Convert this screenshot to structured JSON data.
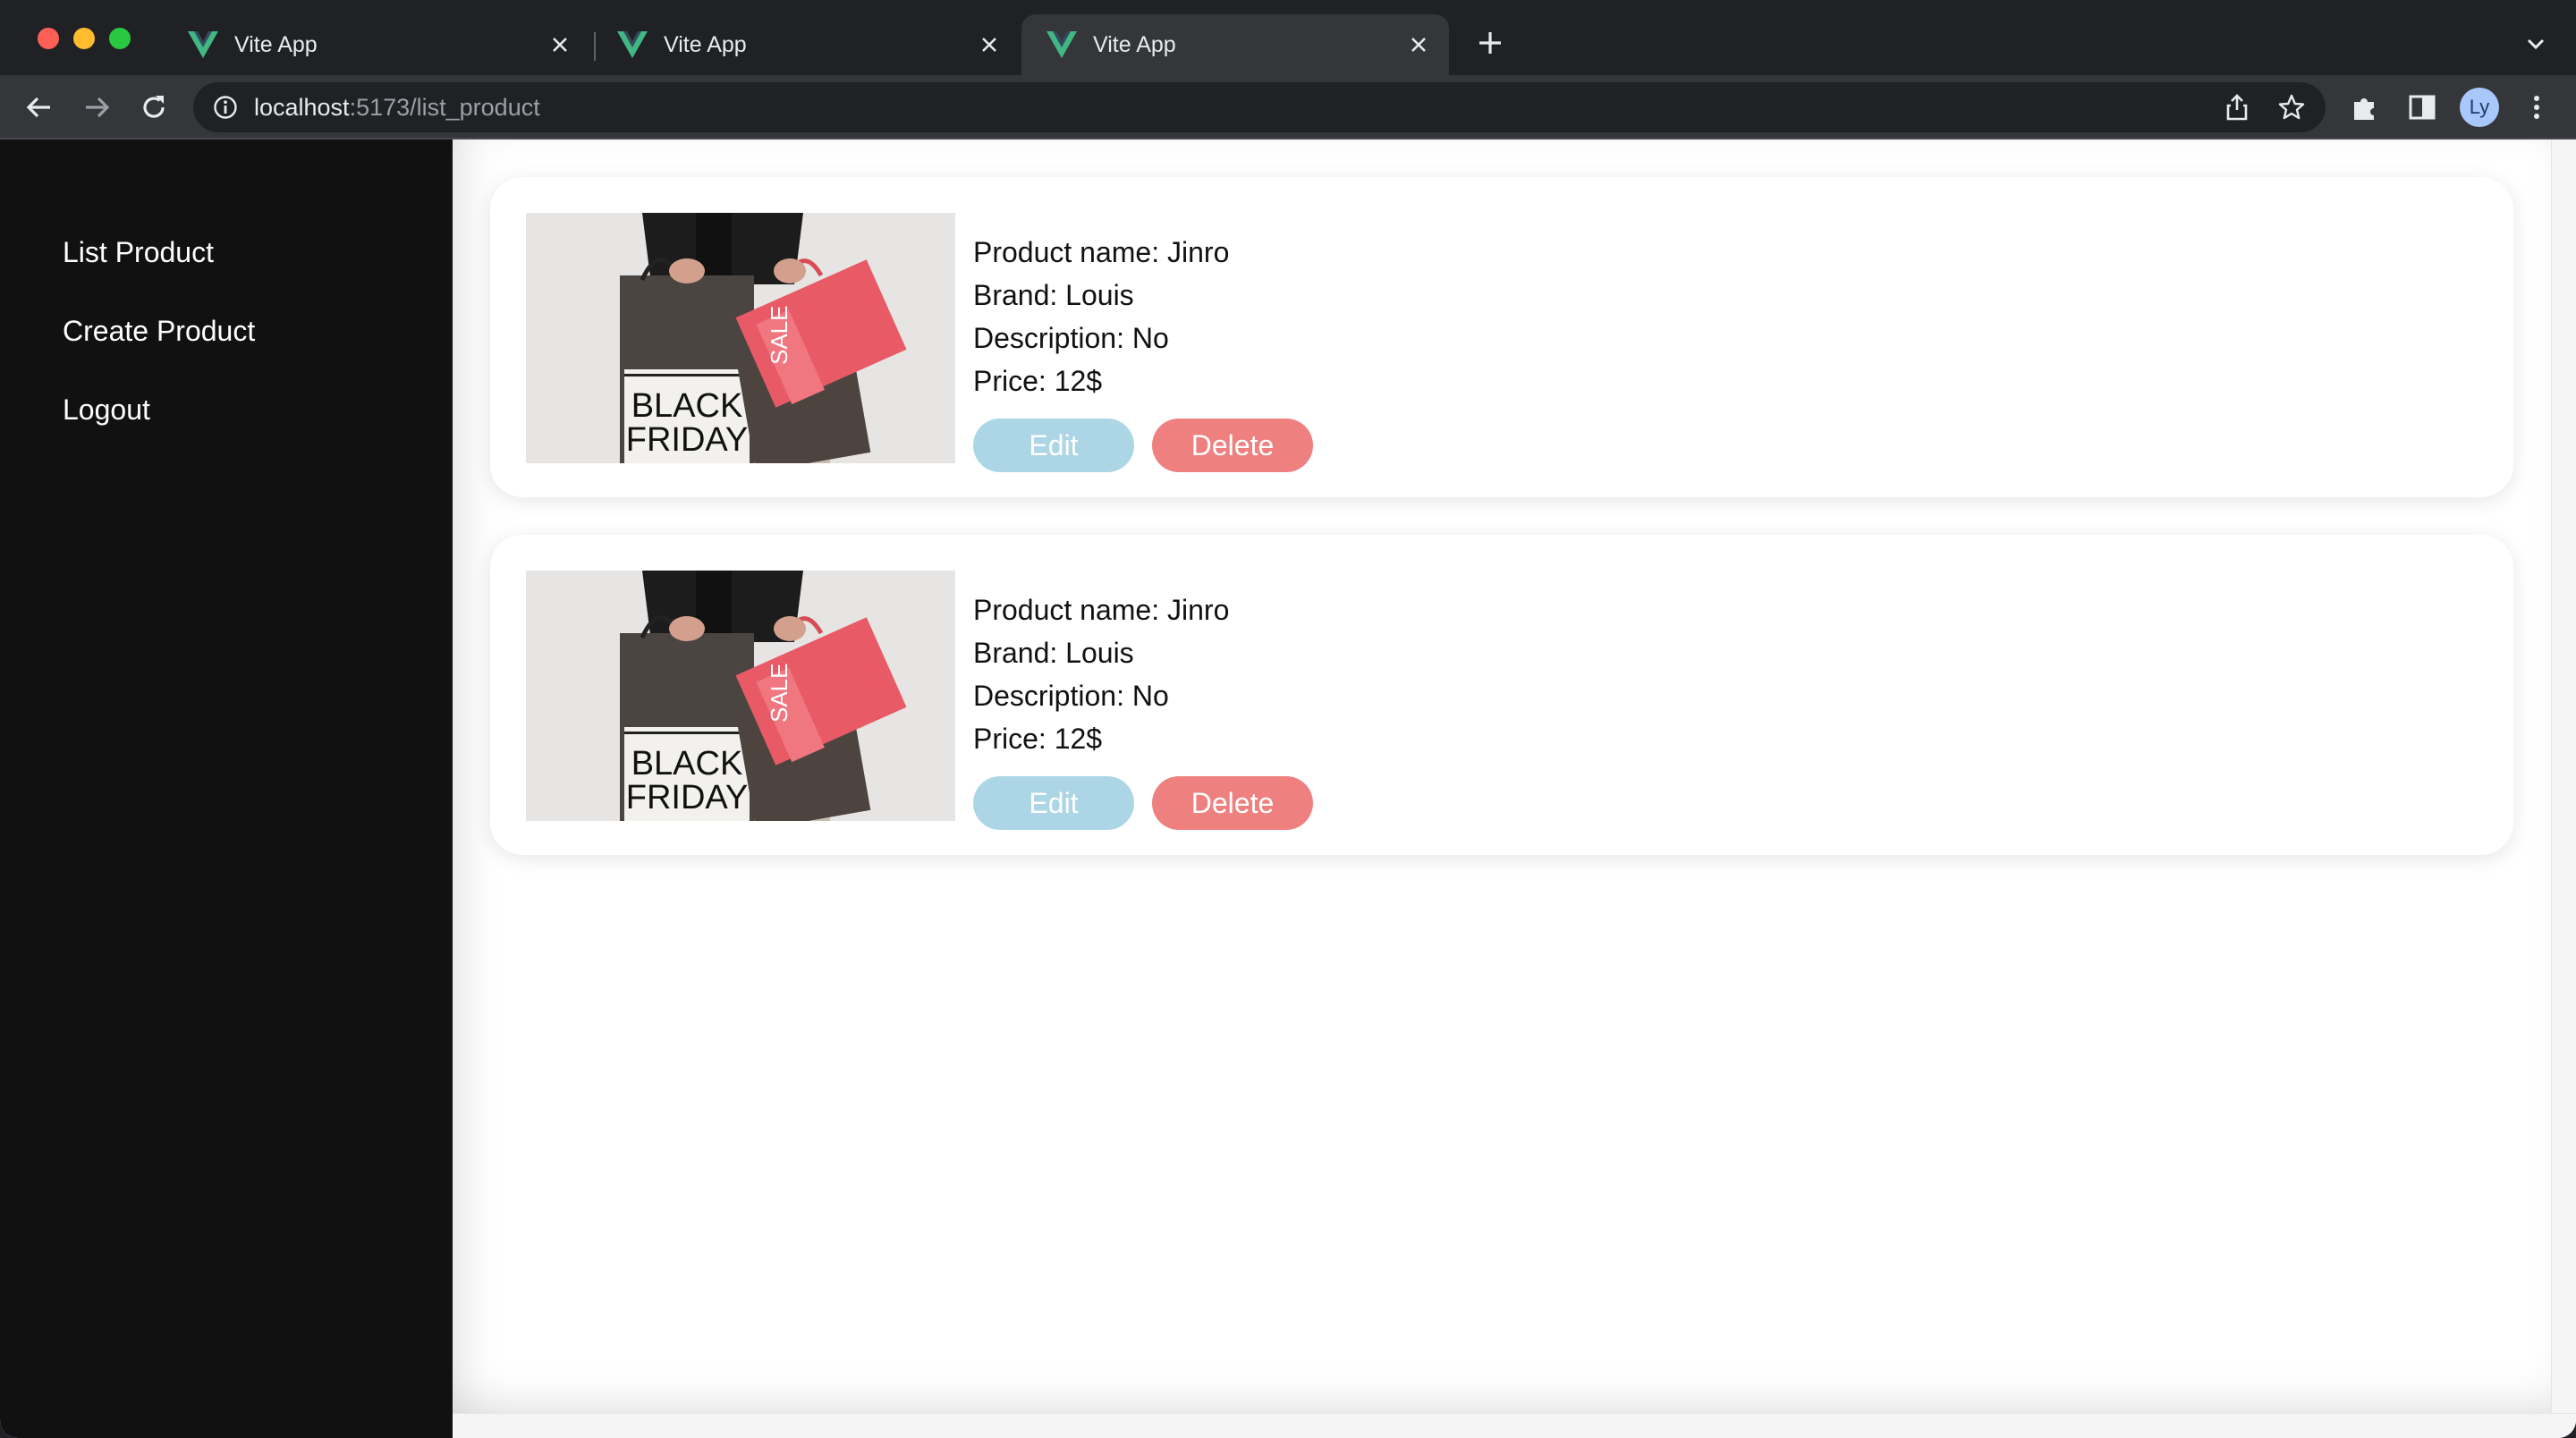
{
  "browser": {
    "tabs": [
      {
        "title": "Vite App",
        "active": false
      },
      {
        "title": "Vite App",
        "active": false
      },
      {
        "title": "Vite App",
        "active": true
      }
    ],
    "url_host": "localhost",
    "url_path": ":5173/list_product",
    "profile_initials": "Ly",
    "favicon_color": "#41b883"
  },
  "sidebar": {
    "items": [
      {
        "label": "List Product"
      },
      {
        "label": "Create Product"
      },
      {
        "label": "Logout"
      }
    ]
  },
  "products": [
    {
      "name_line": "Product name: Jinro",
      "brand_line": "Brand: Louis",
      "description_line": "Description: No",
      "price_line": "Price: 12$",
      "image_text": [
        "BLACK",
        "FRIDAY",
        "SALE"
      ],
      "edit_label": "Edit",
      "delete_label": "Delete"
    },
    {
      "name_line": "Product name: Jinro",
      "brand_line": "Brand: Louis",
      "description_line": "Description: No",
      "price_line": "Price: 12$",
      "image_text": [
        "BLACK",
        "FRIDAY",
        "SALE"
      ],
      "edit_label": "Edit",
      "delete_label": "Delete"
    }
  ],
  "colors": {
    "sidebar_bg": "#111111",
    "edit_button": "#acd5e5",
    "delete_button": "#ee8080"
  }
}
